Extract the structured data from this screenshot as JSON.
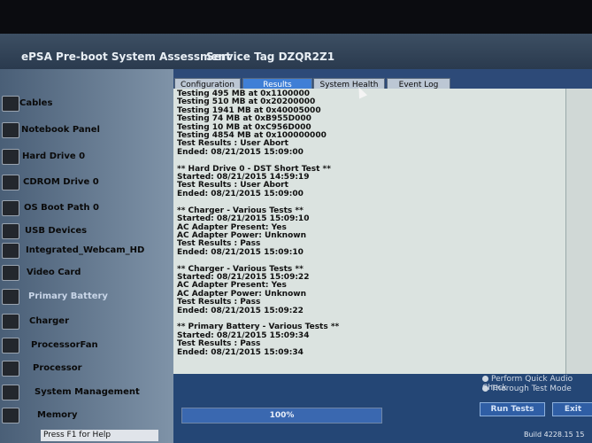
{
  "app": {
    "title": "ePSA Pre-boot System Assessment",
    "service_tag": "Service Tag DZQR2Z1"
  },
  "sidebar": {
    "items": [
      {
        "label": "Cables",
        "icon": "cable-icon"
      },
      {
        "label": "Notebook Panel",
        "icon": "monitor-icon"
      },
      {
        "label": "Hard Drive 0",
        "icon": "hard-drive-icon"
      },
      {
        "label": "CDROM Drive 0",
        "icon": "cdrom-icon"
      },
      {
        "label": "OS Boot Path 0",
        "icon": "boot-path-icon"
      },
      {
        "label": "USB Devices",
        "icon": "usb-icon"
      },
      {
        "label": "Integrated_Webcam_HD",
        "icon": "webcam-icon"
      },
      {
        "label": "Video Card",
        "icon": "video-card-icon"
      },
      {
        "label": "Primary Battery",
        "icon": "battery-icon"
      },
      {
        "label": "Charger",
        "icon": "charger-icon"
      },
      {
        "label": "ProcessorFan",
        "icon": "fan-icon"
      },
      {
        "label": "Processor",
        "icon": "processor-icon"
      },
      {
        "label": "System Management",
        "icon": "system-management-icon"
      },
      {
        "label": "Memory",
        "icon": "memory-icon"
      }
    ]
  },
  "tabs": [
    {
      "label": "Configuration"
    },
    {
      "label": "Results"
    },
    {
      "label": "System Health"
    },
    {
      "label": "Event Log"
    }
  ],
  "log": [
    "Testing 495 MB at 0x1100000",
    "Testing 510 MB at 0x20200000",
    "Testing 1941 MB at 0x40005000",
    "Testing 74 MB at 0xB955D000",
    "Testing 10 MB at 0xC956D000",
    "Testing 4854 MB at 0x100000000",
    "Test Results : User Abort",
    "Ended: 08/21/2015 15:09:00",
    "",
    "** Hard Drive 0 - DST Short Test **",
    "Started: 08/21/2015 14:59:19",
    "Test Results : User Abort",
    "Ended: 08/21/2015 15:09:00",
    "",
    "** Charger - Various Tests **",
    "Started: 08/21/2015 15:09:10",
    "AC Adapter Present: Yes",
    "AC Adapter Power: Unknown",
    "Test Results : Pass",
    "Ended: 08/21/2015 15:09:10",
    "",
    "** Charger - Various Tests **",
    "Started: 08/21/2015 15:09:22",
    "AC Adapter Present: Yes",
    "AC Adapter Power: Unknown",
    "Test Results : Pass",
    "Ended: 08/21/2015 15:09:22",
    "",
    "** Primary Battery - Various Tests **",
    "Started: 08/21/2015 15:09:34",
    "Test Results : Pass",
    "Ended: 08/21/2015 15:09:34"
  ],
  "progress": {
    "label": "100%",
    "percent": 100
  },
  "options": [
    "Perform Quick Audio Check",
    "Thorough Test Mode"
  ],
  "buttons": {
    "run_tests": "Run Tests",
    "exit": "Exit"
  },
  "footer": {
    "help": "Press F1 for Help",
    "build": "Build 4228.15 15"
  },
  "colors": {
    "accent": "#3f7fd6",
    "log_bg": "#dbe3e0",
    "sidebar_bg": "#6d8196"
  }
}
